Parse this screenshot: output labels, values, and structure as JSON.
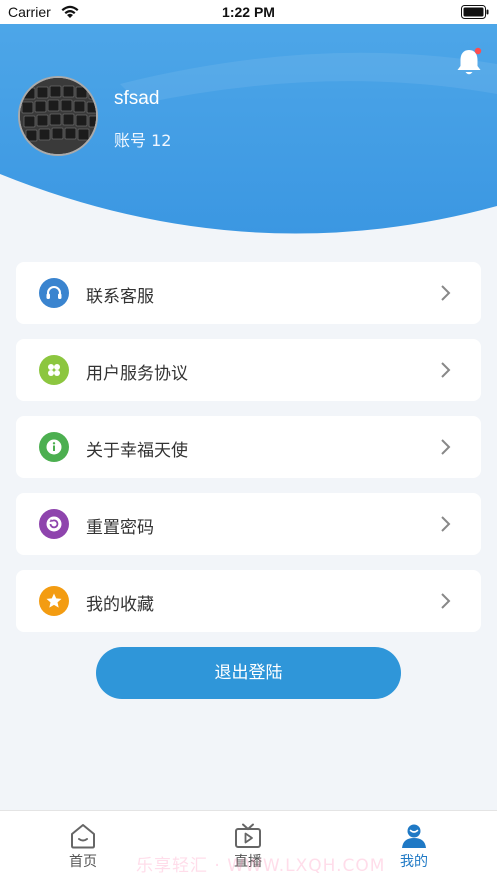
{
  "status_bar": {
    "carrier": "Carrier",
    "time": "1:22 PM"
  },
  "header": {
    "username": "sfsad",
    "account": "账号 12"
  },
  "menu": [
    {
      "label": "联系客服",
      "icon": "headset-icon",
      "color": "#3a84cf"
    },
    {
      "label": "用户服务协议",
      "icon": "grid-icon",
      "color": "#8cc63f"
    },
    {
      "label": "关于幸福天使",
      "icon": "info-icon",
      "color": "#4caf50"
    },
    {
      "label": "重置密码",
      "icon": "reset-icon",
      "color": "#8e44ad"
    },
    {
      "label": "我的收藏",
      "icon": "star-icon",
      "color": "#f39c12"
    }
  ],
  "logout_label": "退出登陆",
  "tabs": [
    {
      "label": "首页",
      "icon": "home-icon"
    },
    {
      "label": "直播",
      "icon": "tv-icon"
    },
    {
      "label": "我的",
      "icon": "user-icon",
      "active": true
    }
  ],
  "watermark": "乐享轻汇 · WWW.LXQH.COM",
  "colors": {
    "primary": "#2f96d9",
    "header_top": "#4aa3e6",
    "active_tab": "#1f79c5"
  }
}
